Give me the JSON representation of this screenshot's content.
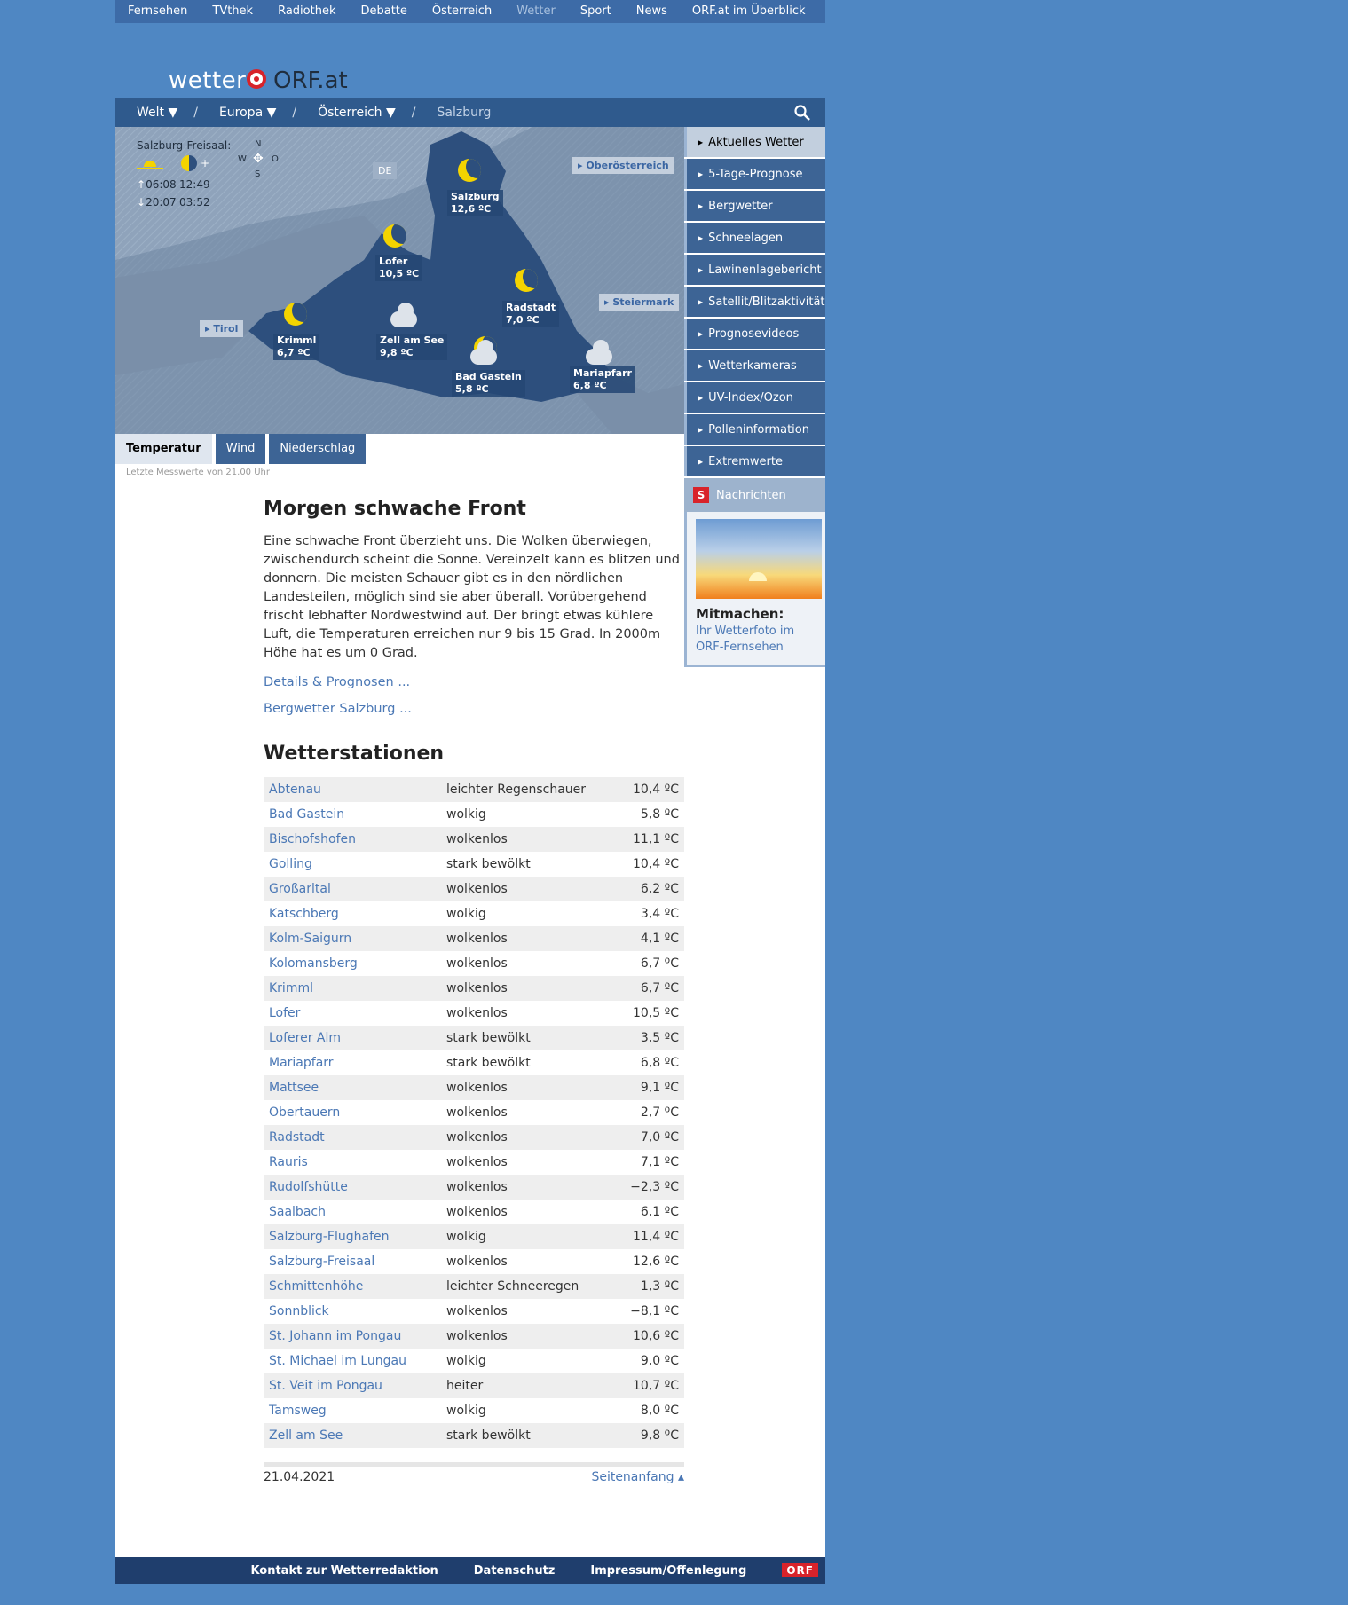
{
  "topnav": [
    "Fernsehen",
    "TVthek",
    "Radiothek",
    "Debatte",
    "Österreich",
    "Wetter",
    "Sport",
    "News",
    "ORF.at im Überblick"
  ],
  "logo": {
    "wetter": "wetter",
    "orf": "ORF.at"
  },
  "breadcrumb": {
    "welt": "Welt",
    "europa": "Europa",
    "oesterreich": "Österreich",
    "current": "Salzburg",
    "sep": "/"
  },
  "map": {
    "station": "Salzburg-Freisaal:",
    "rise_sun": "06:08",
    "set_sun": "20:07",
    "rise_moon": "12:49",
    "set_moon": "03:52",
    "compass": {
      "n": "N",
      "s": "S",
      "w": "W",
      "o": "O"
    },
    "de": "DE",
    "regions": {
      "ooe": "▸ Oberösterreich",
      "stmk": "▸ Steiermark",
      "tirol": "▸ Tirol"
    },
    "cities": [
      {
        "name": "Salzburg",
        "temp": "12,6 ºC"
      },
      {
        "name": "Lofer",
        "temp": "10,5 ºC"
      },
      {
        "name": "Radstadt",
        "temp": "7,0 ºC"
      },
      {
        "name": "Krimml",
        "temp": "6,7 ºC"
      },
      {
        "name": "Zell am See",
        "temp": "9,8 ºC"
      },
      {
        "name": "Bad Gastein",
        "temp": "5,8 ºC"
      },
      {
        "name": "Mariapfarr",
        "temp": "6,8 ºC"
      }
    ]
  },
  "tabs": [
    "Temperatur",
    "Wind",
    "Niederschlag"
  ],
  "last_measure": "Letzte Messwerte von 21.00 Uhr",
  "sidebar": [
    "Aktuelles Wetter",
    "5-Tage-Prognose",
    "Bergwetter",
    "Schneelagen",
    "Lawinenlagebericht",
    "Satellit/Blitzaktivität",
    "Prognosevideos",
    "Wetterkameras",
    "UV-Index/Ozon",
    "Polleninformation",
    "Extremwerte"
  ],
  "news": {
    "icon": "S",
    "label": "Nachrichten"
  },
  "mitmachen": {
    "title": "Mitmachen:",
    "link": "Ihr Wetterfoto im ORF-Fernsehen"
  },
  "article": {
    "title": "Morgen schwache Front",
    "body": "Eine schwache Front überzieht uns. Die Wolken überwiegen, zwischendurch scheint die Sonne. Vereinzelt kann es blitzen und donnern. Die meisten Schauer gibt es in den nördlichen Landesteilen, möglich sind sie aber überall. Vorübergehend frischt lebhafter Nordwestwind auf. Der bringt etwas kühlere Luft, die Temperaturen erreichen nur 9 bis 15 Grad. In 2000m Höhe hat es um 0 Grad.",
    "link1": "Details & Prognosen ...",
    "link2": "Bergwetter Salzburg ...",
    "stations_title": "Wetterstationen"
  },
  "stations": [
    [
      "Abtenau",
      "leichter Regenschauer",
      "10,4 ºC"
    ],
    [
      "Bad Gastein",
      "wolkig",
      "5,8 ºC"
    ],
    [
      "Bischofshofen",
      "wolkenlos",
      "11,1 ºC"
    ],
    [
      "Golling",
      "stark bewölkt",
      "10,4 ºC"
    ],
    [
      "Großarltal",
      "wolkenlos",
      "6,2 ºC"
    ],
    [
      "Katschberg",
      "wolkig",
      "3,4 ºC"
    ],
    [
      "Kolm-Saigurn",
      "wolkenlos",
      "4,1 ºC"
    ],
    [
      "Kolomansberg",
      "wolkenlos",
      "6,7 ºC"
    ],
    [
      "Krimml",
      "wolkenlos",
      "6,7 ºC"
    ],
    [
      "Lofer",
      "wolkenlos",
      "10,5 ºC"
    ],
    [
      "Loferer Alm",
      "stark bewölkt",
      "3,5 ºC"
    ],
    [
      "Mariapfarr",
      "stark bewölkt",
      "6,8 ºC"
    ],
    [
      "Mattsee",
      "wolkenlos",
      "9,1 ºC"
    ],
    [
      "Obertauern",
      "wolkenlos",
      "2,7 ºC"
    ],
    [
      "Radstadt",
      "wolkenlos",
      "7,0 ºC"
    ],
    [
      "Rauris",
      "wolkenlos",
      "7,1 ºC"
    ],
    [
      "Rudolfshütte",
      "wolkenlos",
      "−2,3 ºC"
    ],
    [
      "Saalbach",
      "wolkenlos",
      "6,1 ºC"
    ],
    [
      "Salzburg-Flughafen",
      "wolkig",
      "11,4 ºC"
    ],
    [
      "Salzburg-Freisaal",
      "wolkenlos",
      "12,6 ºC"
    ],
    [
      "Schmittenhöhe",
      "leichter Schneeregen",
      "1,3 ºC"
    ],
    [
      "Sonnblick",
      "wolkenlos",
      "−8,1 ºC"
    ],
    [
      "St. Johann im Pongau",
      "wolkenlos",
      "10,6 ºC"
    ],
    [
      "St. Michael im Lungau",
      "wolkig",
      "9,0 ºC"
    ],
    [
      "St. Veit im Pongau",
      "heiter",
      "10,7 ºC"
    ],
    [
      "Tamsweg",
      "wolkig",
      "8,0 ºC"
    ],
    [
      "Zell am See",
      "stark bewölkt",
      "9,8 ºC"
    ]
  ],
  "date": "21.04.2021",
  "top_link": "Seitenanfang ▴",
  "footer": [
    "Kontakt zur Wetterredaktion",
    "Datenschutz",
    "Impressum/Offenlegung",
    "ORF"
  ]
}
